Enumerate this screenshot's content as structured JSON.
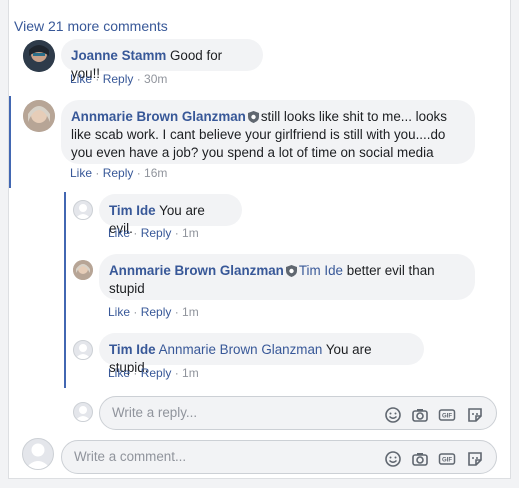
{
  "view_more": "View 21 more comments",
  "comments": [
    {
      "name": "Joanne Stamm",
      "text": "Good for you!!",
      "like": "Like",
      "reply": "Reply",
      "time": "30m"
    },
    {
      "name": "Annmarie Brown Glanzman",
      "line1": "still looks like shit to me... looks",
      "line2": "like scab work. I cant believe your girlfriend is still with you....do",
      "line3": "you even have a job? you spend a lot of time on social media",
      "like": "Like",
      "reply": "Reply",
      "time": "16m"
    }
  ],
  "replies": [
    {
      "name": "Tim Ide",
      "text": "You are evil.",
      "like": "Like",
      "reply": "Reply",
      "time": "1m"
    },
    {
      "name": "Annmarie Brown Glanzman",
      "tag": "Tim Ide",
      "text1": "better evil than",
      "text2": "stupid",
      "like": "Like",
      "reply": "Reply",
      "time": "1m"
    },
    {
      "name": "Tim Ide",
      "tag": "Annmarie Brown Glanzman",
      "text": "You are stupid.",
      "like": "Like",
      "reply": "Reply",
      "time": "1m"
    }
  ],
  "reply_input": {
    "placeholder": "Write a reply..."
  },
  "comment_input": {
    "placeholder": "Write a comment..."
  },
  "icons": {
    "emoji": "emoji-icon",
    "camera": "camera-icon",
    "gif_label": "GIF",
    "sticker": "sticker-icon"
  },
  "colors": {
    "link": "#385898",
    "thread": "#4267b2",
    "bubble": "#f2f3f5"
  }
}
